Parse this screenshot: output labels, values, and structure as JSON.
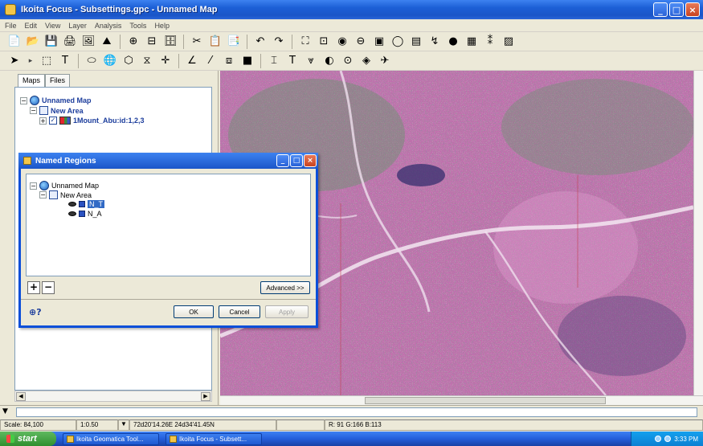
{
  "window": {
    "title": "Ikoita Focus - Subsettings.gpc - Unnamed Map",
    "controls": [
      "_",
      "□",
      "×"
    ]
  },
  "menubar": [
    "File",
    "Edit",
    "View",
    "Layer",
    "Analysis",
    "Tools",
    "Help"
  ],
  "toolbar1": [
    "📄",
    "📂",
    "💾",
    "🖨",
    "🖼",
    "⛰",
    "⊕",
    "⊟",
    "🗄",
    "✂",
    "📋",
    "📑",
    "↶",
    "↷",
    "⛶",
    "⊡",
    "◉",
    "⊖",
    "▣",
    "◯",
    "▤",
    "↯",
    "●",
    "▦",
    "⁑",
    "▨"
  ],
  "toolbar2": [
    "➤",
    "▸",
    "⬚",
    "T",
    "⬭",
    "🌐",
    "⬡",
    "⧖",
    "✛",
    "∠",
    "⁄",
    "⧈",
    "■",
    "⌶",
    "T",
    "⩔",
    "◐",
    "⊙",
    "◈",
    "✈"
  ],
  "leftpanel": {
    "tabs": [
      "Maps",
      "Files"
    ],
    "tree": {
      "map_label": "Unnamed Map",
      "area_label": "New Area",
      "layer_label": "1Mount_Abu:id:1,2,3"
    }
  },
  "dialog": {
    "title": "Named Regions",
    "tree": {
      "map_label": "Unnamed Map",
      "area_label": "New Area",
      "regions": [
        "N_T",
        "N_A"
      ]
    },
    "add_label": "+",
    "remove_label": "−",
    "advanced_label": "Advanced >>",
    "help_label": "?",
    "ok_label": "OK",
    "cancel_label": "Cancel",
    "apply_label": "Apply"
  },
  "statusbar": {
    "scale": "Scale: 84,100",
    "zoom": "1:0.50",
    "coords": "72d20'14.26E  24d34'41.45N",
    "empty": "",
    "rgb": "R: 91 G:166 B:113"
  },
  "taskbar": {
    "start_label": "start",
    "tasks": [
      "Ikoita Geomatica Tool...",
      "Ikoita Focus - Subsett..."
    ],
    "clock": "3:33 PM"
  },
  "colors": {
    "title_blue": "#1a55c8",
    "selection": "#316ac5",
    "map_magenta": "#b55da0",
    "vegetation_green": "#4f9b5c"
  }
}
